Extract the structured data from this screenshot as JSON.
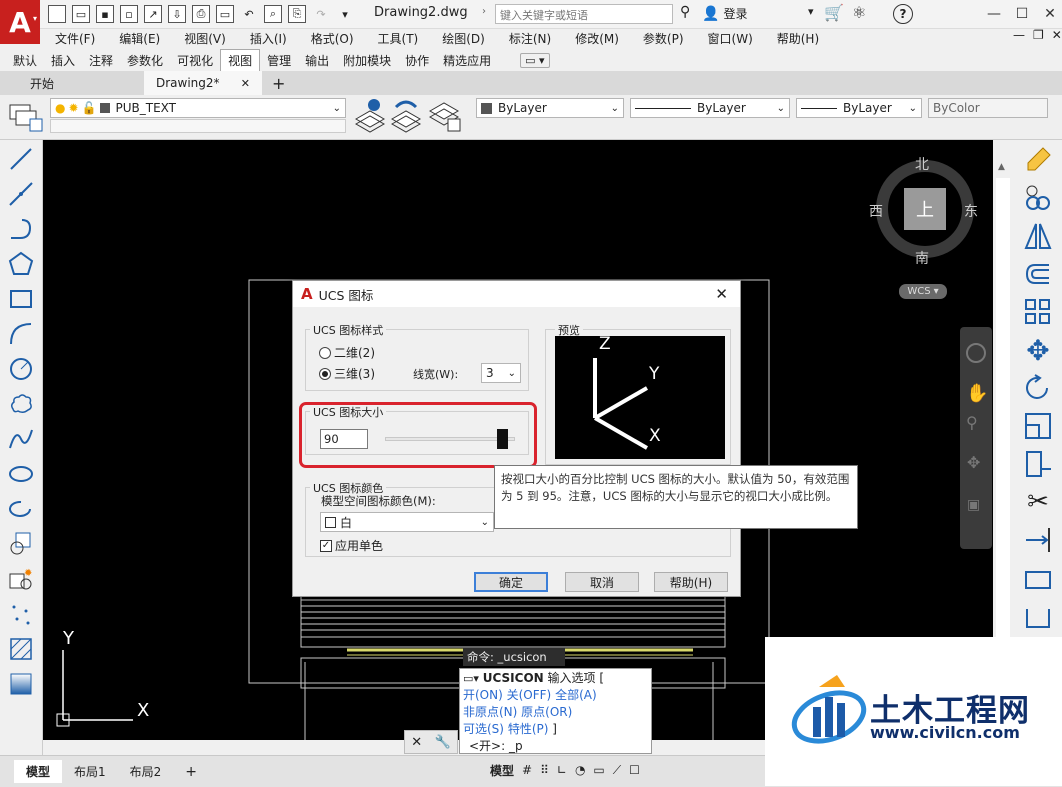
{
  "app": {
    "logo_letter": "A",
    "document_title": "Drawing2.dwg",
    "search_placeholder": "键入关键字或短语",
    "login_label": "登录",
    "help_label": "?"
  },
  "menu": [
    "文件(F)",
    "编辑(E)",
    "视图(V)",
    "插入(I)",
    "格式(O)",
    "工具(T)",
    "绘图(D)",
    "标注(N)",
    "修改(M)",
    "参数(P)",
    "窗口(W)",
    "帮助(H)"
  ],
  "ribbon_tabs": [
    {
      "label": "默认",
      "active": false
    },
    {
      "label": "插入",
      "active": false
    },
    {
      "label": "注释",
      "active": false
    },
    {
      "label": "参数化",
      "active": false
    },
    {
      "label": "可视化",
      "active": false
    },
    {
      "label": "视图",
      "active": true
    },
    {
      "label": "管理",
      "active": false
    },
    {
      "label": "输出",
      "active": false
    },
    {
      "label": "附加模块",
      "active": false
    },
    {
      "label": "协作",
      "active": false
    },
    {
      "label": "精选应用",
      "active": false
    }
  ],
  "doc_tabs": [
    {
      "label": "开始",
      "active": false
    },
    {
      "label": "Drawing2*",
      "active": true
    }
  ],
  "toolbar": {
    "layer": "PUB_TEXT",
    "color": "ByLayer",
    "linetype": "ByLayer",
    "lineweight": "ByLayer",
    "plotstyle": "ByColor"
  },
  "viewcube": {
    "north": "北",
    "south": "南",
    "east": "东",
    "west": "西",
    "face": "上",
    "ucs_label": "WCS"
  },
  "canvas": {
    "ucs_y_label": "Y",
    "ucs_x_label": "X",
    "command_prompt": "命令: _ucsicon"
  },
  "dialog": {
    "title": "UCS 图标",
    "style_group": "UCS 图标样式",
    "radio_2d": "二维(2)",
    "radio_3d": "三维(3)",
    "style_selected": "3d",
    "linewidth_label": "线宽(W):",
    "linewidth_value": "3",
    "preview_label": "预览",
    "preview_z": "Z",
    "preview_y": "Y",
    "preview_x": "X",
    "size_group": "UCS 图标大小",
    "size_value": "90",
    "size_min": 5,
    "size_max": 95,
    "color_group": "UCS 图标颜色",
    "model_color_label": "模型空间图标颜色(M):",
    "model_color_value": "白",
    "mono_label": "应用单色",
    "mono_checked": true,
    "ok": "确定",
    "cancel": "取消",
    "help": "帮助(H)"
  },
  "tooltip": {
    "text": "按视口大小的百分比控制 UCS 图标的大小。默认值为 50，有效范围为 5 到 95。注意，UCS 图标的大小与显示它的视口大小成比例。"
  },
  "command_window": {
    "line1_cmd": "UCSICON",
    "line1_text": "输入选项 [",
    "opt_on": "开(ON)",
    "opt_off": "关(OFF)",
    "opt_all": "全部(A)",
    "opt_noorigin": "非原点(N)",
    "opt_origin": "原点(OR)",
    "opt_select": "可选(S)",
    "opt_props": "特性(P)",
    "bracket_close": "]",
    "current": "<开>: _p"
  },
  "layout_tabs": [
    {
      "label": "模型",
      "active": true
    },
    {
      "label": "布局1",
      "active": false
    },
    {
      "label": "布局2",
      "active": false
    }
  ],
  "status": {
    "model_label": "模型"
  },
  "watermark": {
    "title": "土木工程网",
    "url": "www.civilcn.com"
  },
  "colors": {
    "highlight_red": "#d9232d",
    "logo_red": "#c8201e",
    "accent_blue": "#1f5fa8"
  }
}
